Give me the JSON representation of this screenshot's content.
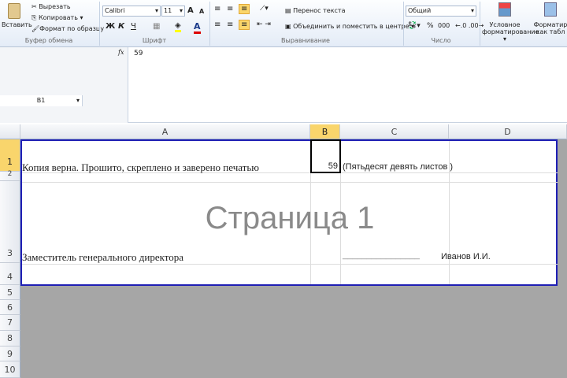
{
  "ribbon": {
    "clipboard": {
      "paste": "Вставить",
      "cut": "Вырезать",
      "copy": "Копировать",
      "format_painter": "Формат по образцу",
      "label": "Буфер обмена"
    },
    "font": {
      "name": "Calibri",
      "size": "11",
      "bold": "Ж",
      "italic": "К",
      "underline": "Ч",
      "label": "Шрифт",
      "grow": "A",
      "shrink": "A",
      "color": "A"
    },
    "alignment": {
      "wrap": "Перенос текста",
      "merge": "Объединить и поместить в центре",
      "label": "Выравнивание"
    },
    "number": {
      "format": "Общий",
      "percent": "%",
      "thousands": "000",
      "label": "Число"
    },
    "styles": {
      "conditional": "Условное форматирование",
      "table": "Форматировать как таблицу",
      "conditional_l1": "Условное",
      "conditional_l2": "форматирование",
      "table_l1": "Форматир",
      "table_l2": "как табл"
    }
  },
  "formula_bar": {
    "name_box": "B1",
    "fx": "fx",
    "value": "59"
  },
  "columns": [
    "A",
    "B",
    "C",
    "D"
  ],
  "rows": [
    "1",
    "2",
    "3",
    "4",
    "5",
    "6",
    "7",
    "8",
    "9",
    "10"
  ],
  "cells": {
    "A1": "Копия верна. Прошито, скреплено и заверено печатью",
    "B1": "59",
    "C1": "(Пятьдесят девять листов )",
    "A3": "Заместитель генерального директора",
    "C3_line": "________________",
    "D3": "Иванов И.И."
  },
  "watermark": "Страница 1"
}
